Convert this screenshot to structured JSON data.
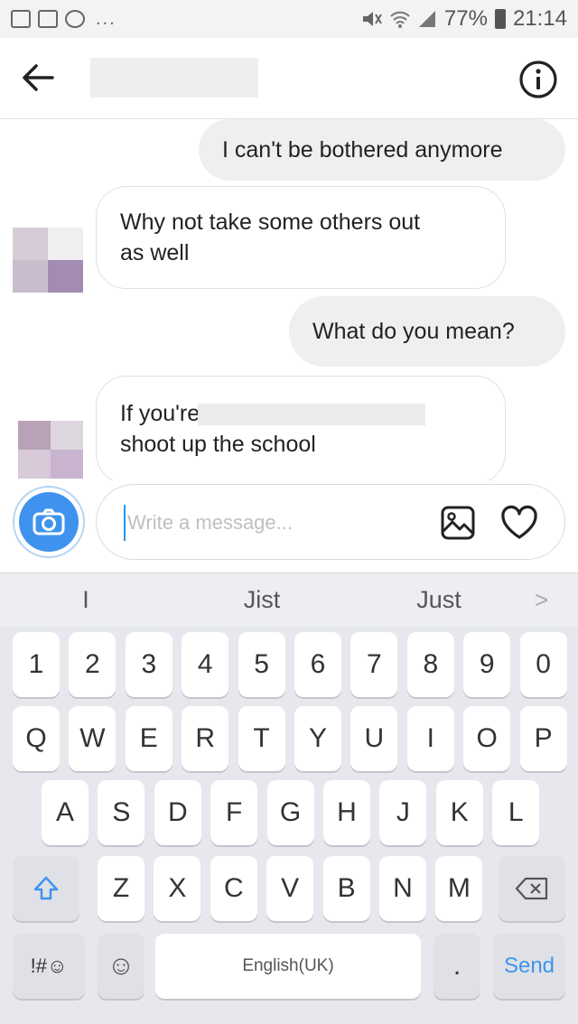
{
  "status_bar": {
    "battery": "77%",
    "time": "21:14",
    "notification_icons": [
      "gallery-icon",
      "message-icon",
      "notes-icon"
    ],
    "more": "..."
  },
  "header": {
    "back_icon": "arrow-left-icon",
    "info_icon": "info-icon"
  },
  "messages": [
    {
      "sender": "me",
      "text": "I can't be bothered anymore"
    },
    {
      "sender": "them",
      "lines": [
        "Why not take some others out",
        "as well"
      ]
    },
    {
      "sender": "me",
      "text": "What do you mean?"
    },
    {
      "sender": "them",
      "lines": [
        "If you're",
        "shoot up the school"
      ]
    }
  ],
  "composer": {
    "placeholder": "Write a message...",
    "camera_icon": "camera-icon",
    "gallery_icon": "image-icon",
    "like_icon": "heart-icon"
  },
  "keyboard": {
    "suggestions": [
      "I",
      "Jist",
      "Just"
    ],
    "suggestions_more": ">",
    "row_numbers": [
      "1",
      "2",
      "3",
      "4",
      "5",
      "6",
      "7",
      "8",
      "9",
      "0"
    ],
    "row_top": [
      "Q",
      "W",
      "E",
      "R",
      "T",
      "Y",
      "U",
      "I",
      "O",
      "P"
    ],
    "row_mid": [
      "A",
      "S",
      "D",
      "F",
      "G",
      "H",
      "J",
      "K",
      "L"
    ],
    "row_bottom": [
      "Z",
      "X",
      "C",
      "V",
      "B",
      "N",
      "M"
    ],
    "symbols_key": "!#☺",
    "emoji_key": "☺",
    "space_label": "English(UK)",
    "period_key": ".",
    "send_label": "Send",
    "accent_color": "#3f93ee"
  }
}
